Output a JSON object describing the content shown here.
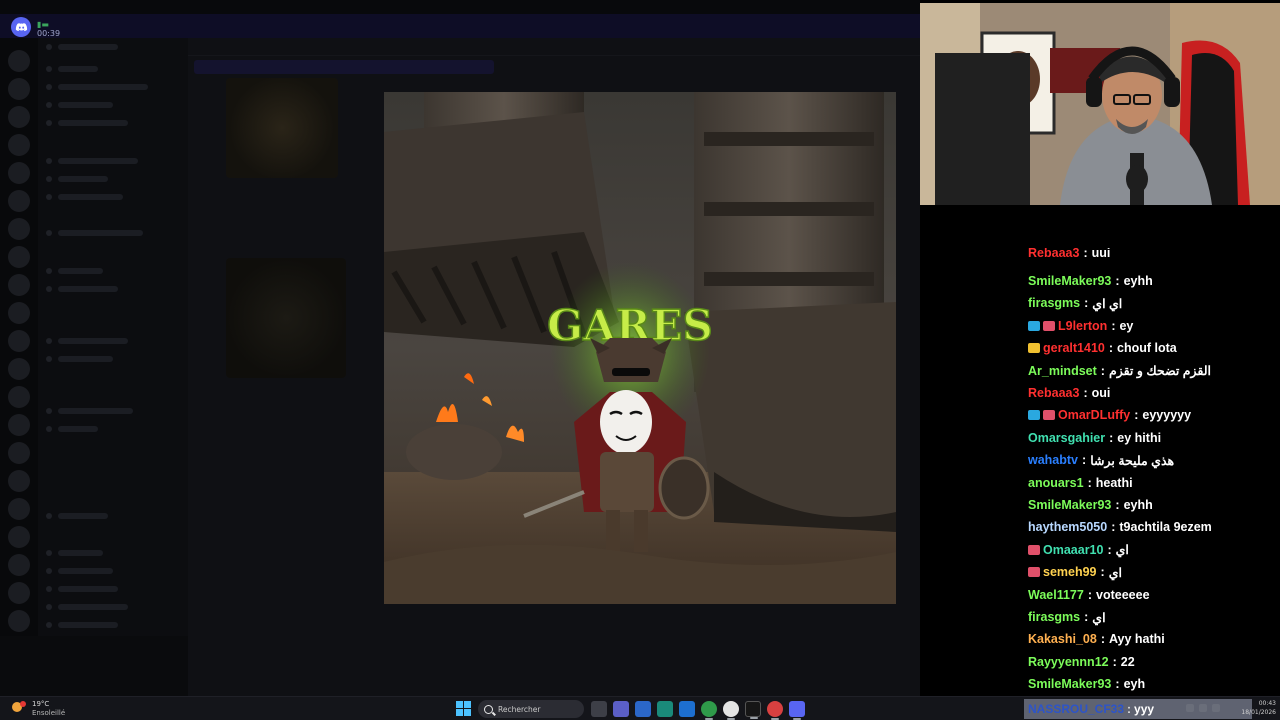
{
  "discord": {
    "call_timer": "00:39",
    "colors": {
      "brand": "#5865f2",
      "overlay_strip": "#0e0d26"
    }
  },
  "modal_image": {
    "title_text": "GARES",
    "colors": {
      "title": "#b8e23a",
      "smoke": "#6fb82a",
      "ground": "#5a4a3a",
      "fire": "#ff7a1a"
    }
  },
  "chat": {
    "partial_line": {
      "username": "Rebaaa3",
      "text": "uui",
      "color": "#ff3030"
    },
    "lines": [
      {
        "username": "SmileMaker93",
        "text": "eyhh",
        "color": "#7cfc5a",
        "badges": []
      },
      {
        "username": "firasgms",
        "text": "اي اي",
        "color": "#7cfc5a",
        "badges": []
      },
      {
        "username": "L9lerton",
        "text": "ey",
        "color": "#ff3030",
        "badges": [
          "#2aa8e0",
          "#e0506a"
        ]
      },
      {
        "username": "geralt1410",
        "text": "chouf lota",
        "color": "#ff3030",
        "badges": [
          "#f0c030"
        ]
      },
      {
        "username": "Ar_mindset",
        "text": "القزم تضحك و تقزم",
        "color": "#7cfc5a",
        "badges": []
      },
      {
        "username": "Rebaaa3",
        "text": "oui",
        "color": "#ff3030",
        "badges": []
      },
      {
        "username": "OmarDLuffy",
        "text": "eyyyyyy",
        "color": "#ff3030",
        "badges": [
          "#2aa8e0",
          "#e0506a"
        ]
      },
      {
        "username": "Omarsgahier",
        "text": "ey hithi",
        "color": "#40e0b0",
        "badges": []
      },
      {
        "username": "wahabtv",
        "text": "هذي مليحة برشا",
        "color": "#2a7fff",
        "badges": []
      },
      {
        "username": "anouars1",
        "text": "heathi",
        "color": "#7cfc5a",
        "badges": []
      },
      {
        "username": "SmileMaker93",
        "text": "eyhh",
        "color": "#7cfc5a",
        "badges": []
      },
      {
        "username": "haythem5050",
        "text": "t9achtila 9ezem",
        "color": "#b8d8ff",
        "badges": []
      },
      {
        "username": "Omaaar10",
        "text": "اي",
        "color": "#40e0b0",
        "badges": [
          "#e0506a"
        ]
      },
      {
        "username": "semeh99",
        "text": "اي",
        "color": "#ffd250",
        "badges": [
          "#e0506a"
        ]
      },
      {
        "username": "Wael1177",
        "text": "voteeeee",
        "color": "#7cfc5a",
        "badges": []
      },
      {
        "username": "firasgms",
        "text": "اي",
        "color": "#7cfc5a",
        "badges": []
      },
      {
        "username": "Kakashi_08",
        "text": "Ayy hathi",
        "color": "#ffb050",
        "badges": []
      },
      {
        "username": "Rayyyennn12",
        "text": "22",
        "color": "#7cfc5a",
        "badges": []
      },
      {
        "username": "SmileMaker93",
        "text": "eyh",
        "color": "#7cfc5a",
        "badges": []
      }
    ]
  },
  "taskbar": {
    "weather_temp": "19°C",
    "weather_condition": "Ensoleillé",
    "search_placeholder": "Rechercher",
    "overlay_chat": {
      "username": "NASSROU_CF33",
      "text": "yyy"
    },
    "clock_time": "00:43",
    "clock_date": "18/01/2026",
    "apps": [
      "file-explorer",
      "teams",
      "store",
      "edge",
      "mail",
      "chrome",
      "obs",
      "capcut",
      "app-red",
      "discord"
    ]
  }
}
